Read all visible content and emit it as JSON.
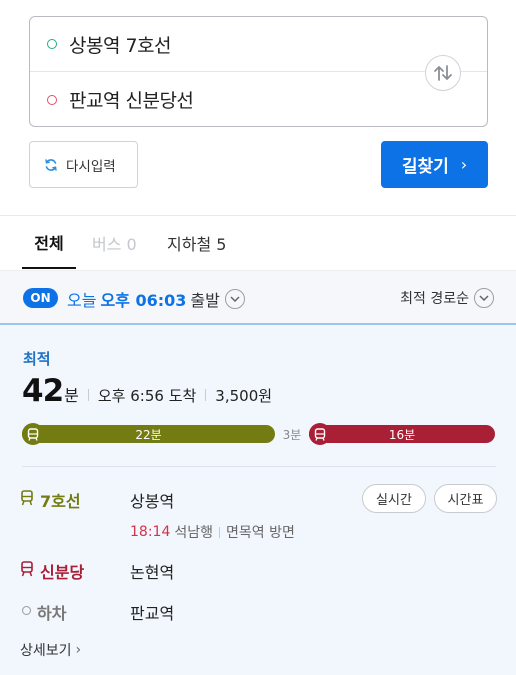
{
  "search": {
    "start": "상봉역 7호선",
    "end": "판교역 신분당선",
    "reset_label": "다시입력",
    "find_label": "길찾기"
  },
  "tabs": [
    {
      "label": "전체"
    },
    {
      "label": "버스 0"
    },
    {
      "label": "지하철 5"
    }
  ],
  "filter": {
    "on_badge": "ON",
    "day": "오늘",
    "time": "오후 06:03",
    "suffix": "출발",
    "sort": "최적 경로순"
  },
  "route": {
    "tag": "최적",
    "minutes": "42",
    "minutes_unit": "분",
    "arrival": "오후 6:56 도착",
    "fare": "3,500원",
    "segments": [
      {
        "label": "22분",
        "color": "#737c12"
      },
      {
        "label": "3분",
        "type": "walk"
      },
      {
        "label": "16분",
        "color": "#a91f36"
      }
    ],
    "legs": [
      {
        "line": "7호선",
        "station": "상봉역",
        "color": "#737c12",
        "next_time": "18:14",
        "next_dest": "석남행",
        "direction": "면목역 방면"
      },
      {
        "line": "신분당",
        "station": "논현역",
        "color": "#a91f36"
      },
      {
        "line": "하차",
        "station": "판교역"
      }
    ],
    "realtime_label": "실시간",
    "timetable_label": "시간표",
    "detail_label": "상세보기"
  },
  "colors": {
    "accent": "#0c72e6",
    "line7": "#737c12",
    "shinbundang": "#a91f36"
  }
}
